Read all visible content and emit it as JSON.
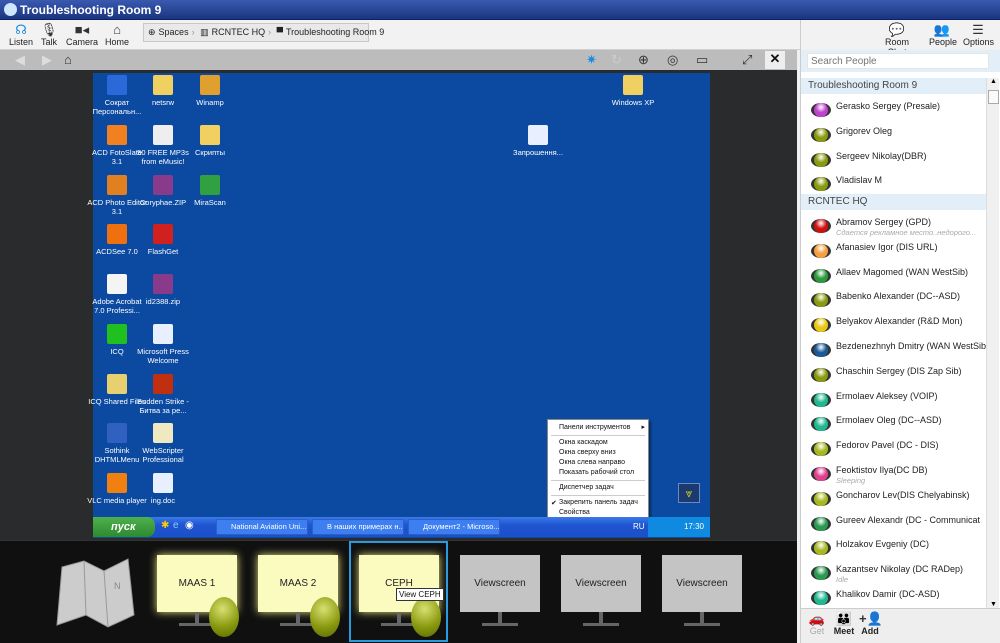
{
  "window": {
    "title": "Troubleshooting Room 9"
  },
  "toolbar": {
    "buttons": [
      {
        "label": "Listen",
        "icon": "headphones-icon"
      },
      {
        "label": "Talk",
        "icon": "microphone-icon"
      },
      {
        "label": "Camera",
        "icon": "camera-icon"
      },
      {
        "label": "Home",
        "icon": "home-icon"
      }
    ],
    "breadcrumb": [
      "Spaces",
      "RCNTEC HQ",
      "Troubleshooting Room 9"
    ],
    "right": [
      {
        "label": "Room Chat",
        "icon": "chat-icon"
      },
      {
        "label": "People",
        "icon": "people-icon"
      },
      {
        "label": "Options",
        "icon": "menu-icon"
      }
    ]
  },
  "desktop": {
    "icons": [
      {
        "label": "Сократ Персональн...",
        "color": "#2a6ad8"
      },
      {
        "label": "netsrw",
        "color": "#f0d060"
      },
      {
        "label": "Winamp",
        "color": "#e0a030"
      },
      {
        "label": "ACD FotoSlate 3.1",
        "color": "#f08020"
      },
      {
        "label": "50 FREE MP3s from eMusic!",
        "color": "#eeeeee"
      },
      {
        "label": "Скрипты",
        "color": "#f0d060"
      },
      {
        "label": "ACD Photo Editor 3.1",
        "color": "#e08020"
      },
      {
        "label": "Coryphae.ZIP",
        "color": "#8a3a8a"
      },
      {
        "label": "MiraScan",
        "color": "#30a040"
      },
      {
        "label": "ACDSee 7.0",
        "color": "#f07010"
      },
      {
        "label": "FlashGet",
        "color": "#d02020"
      },
      null,
      {
        "label": "Adobe Acrobat 7.0 Professi...",
        "color": "#f4f4f4"
      },
      {
        "label": "id2388.zip",
        "color": "#8a3a8a"
      },
      null,
      {
        "label": "ICQ",
        "color": "#20c020"
      },
      {
        "label": "Microsoft Press Welcome",
        "color": "#e8f0ff"
      },
      null,
      {
        "label": "ICQ Shared Files",
        "color": "#e8d070"
      },
      {
        "label": "Sudden Strike - Битва за ре...",
        "color": "#c03010"
      },
      null,
      {
        "label": "Sothink DHTMLMenu",
        "color": "#3060c0"
      },
      {
        "label": "WebScripter Professional",
        "color": "#f0e8c0"
      },
      null,
      {
        "label": "VLC media player",
        "color": "#f08010"
      },
      {
        "label": "ing.doc",
        "color": "#e8f0ff"
      },
      null
    ],
    "extra": [
      {
        "label": "Windows XP",
        "color": "#f0d060"
      },
      {
        "label": "Запрошення...",
        "color": "#e8f0ff"
      }
    ],
    "context_menu": {
      "items": [
        "Панели инструментов",
        "Окна каскадом",
        "Окна сверху вниз",
        "Окна слева направо",
        "Показать рабочий стол",
        "Диспетчер задач",
        "Закрепить панель задач",
        "Свойства"
      ],
      "checked": "Закрепить панель задач",
      "submenu_arrow": "▸",
      "check": "✔"
    },
    "taskbar": {
      "start": "пуск",
      "tasks": [
        "National Aviation Uni...",
        "В наших примерах н...",
        "Документ2 - Microso..."
      ],
      "lang": "RU",
      "clock": "17:30"
    }
  },
  "viewscreens": [
    {
      "label": "MAAS 1",
      "active": true
    },
    {
      "label": "MAAS 2",
      "active": true
    },
    {
      "label": "CEPH",
      "active": true,
      "tooltip": "View CEPH"
    },
    {
      "label": "Viewscreen",
      "active": false
    },
    {
      "label": "Viewscreen",
      "active": false
    },
    {
      "label": "Viewscreen",
      "active": false
    }
  ],
  "people": {
    "search_placeholder": "Search People",
    "groups": [
      {
        "name": "Troubleshooting Room 9",
        "members": [
          {
            "name": "Gerasko Sergey (Presale)",
            "color": "#c040d0"
          },
          {
            "name": "Grigorev Oleg",
            "color": "#8a9a10"
          },
          {
            "name": "Sergeev Nikolay(DBR)",
            "color": "#8a9a10"
          },
          {
            "name": "Vladislav M",
            "color": "#8a9a10"
          }
        ]
      },
      {
        "name": "RCNTEC HQ",
        "members": [
          {
            "name": "Abramov Sergey (GPD)",
            "status": "Сдается рекламное место..недорого...",
            "color": "#d01010"
          },
          {
            "name": "Afanasiev Igor (DIS URL)",
            "color": "#f5a040"
          },
          {
            "name": "Allaev Magomed (WAN WestSib)",
            "color": "#2a9a3a"
          },
          {
            "name": "Babenko Alexander (DC--ASD)",
            "color": "#8a9a10"
          },
          {
            "name": "Belyakov Alexander (R&D Mon)",
            "color": "#e8c810"
          },
          {
            "name": "Bezdenezhnyh Dmitry (WAN WestSib",
            "color": "#1a5a9a"
          },
          {
            "name": "Chaschin Sergey (DIS Zap Sib)",
            "color": "#8a9a10"
          },
          {
            "name": "Ermolaev Aleksey (VOIP)",
            "color": "#20b890"
          },
          {
            "name": "Ermolaev Oleg (DC--ASD)",
            "color": "#20b890"
          },
          {
            "name": "Fedorov Pavel (DC - DIS)",
            "color": "#a8b820"
          },
          {
            "name": "Feoktistov Ilya(DC DB)",
            "status": "Sleeping",
            "color": "#e04090"
          },
          {
            "name": "Goncharov Lev(DIS Chelyabinsk)",
            "color": "#a8b820"
          },
          {
            "name": "Gureev Alexandr (DC - Communicat",
            "color": "#2a9a50"
          },
          {
            "name": "Holzakov Evgeniy (DC)",
            "color": "#a8b820"
          },
          {
            "name": "Kazantsev  Nikolay (DC RADep)",
            "status": "Idle",
            "color": "#2a9a50"
          },
          {
            "name": "Khalikov Damir (DC-ASD)",
            "color": "#20b890"
          }
        ]
      }
    ],
    "bottom": [
      {
        "label": "Get",
        "icon": "car-icon"
      },
      {
        "label": "Meet",
        "icon": "meet-icon"
      },
      {
        "label": "Add",
        "icon": "add-person-icon"
      }
    ]
  }
}
